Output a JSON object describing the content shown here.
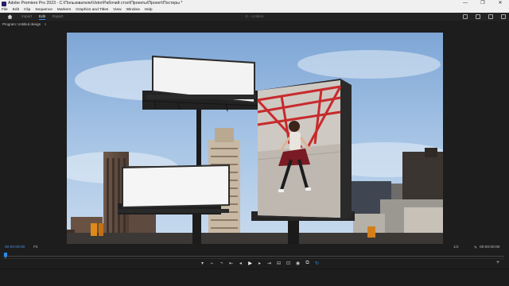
{
  "window": {
    "title": "Adobe Premiere Pro 2023 - C:\\Пользователи\\Vetor\\Рабочий стол\\Проекты\\Проект\\Постеры *",
    "controls": [
      "—",
      "❐",
      "✕"
    ]
  },
  "menu": [
    "File",
    "Edit",
    "Clip",
    "Sequence",
    "Markers",
    "Graphics and Titles",
    "View",
    "Window",
    "Help"
  ],
  "workspace": {
    "tabs": [
      {
        "label": "Import"
      },
      {
        "label": "Edit"
      },
      {
        "label": "Export"
      }
    ],
    "active_tab": "Edit",
    "center_title": "E - Untitled"
  },
  "panel": {
    "title": "Program: Untitled design",
    "menu_glyph": "≡"
  },
  "playback": {
    "current_timecode": "00:00:00:00",
    "fit": "Fit",
    "quality": "1/2",
    "duration_timecode": "00:00:00:00",
    "playhead_position": 0
  },
  "transport": {
    "buttons": [
      {
        "name": "add-marker-icon",
        "glyph": "▾"
      },
      {
        "name": "mark-in-icon",
        "glyph": "⌐"
      },
      {
        "name": "mark-out-icon",
        "glyph": "¬"
      },
      {
        "name": "go-to-in-icon",
        "glyph": "⇤"
      },
      {
        "name": "step-back-icon",
        "glyph": "◂"
      },
      {
        "name": "play-icon",
        "glyph": "▶"
      },
      {
        "name": "step-forward-icon",
        "glyph": "▸"
      },
      {
        "name": "go-to-out-icon",
        "glyph": "⇥"
      },
      {
        "name": "insert-icon",
        "glyph": "⊟"
      },
      {
        "name": "overwrite-icon",
        "glyph": "⊡"
      },
      {
        "name": "export-frame-icon",
        "glyph": "◉"
      },
      {
        "name": "compare-icon",
        "glyph": "⧉"
      },
      {
        "name": "loop-icon",
        "glyph": "↻"
      }
    ],
    "add_glyph": "+"
  },
  "colors": {
    "accent": "#2d8ceb",
    "panel_bg": "#1d1d1d",
    "timecode": "#4a8fe0"
  }
}
